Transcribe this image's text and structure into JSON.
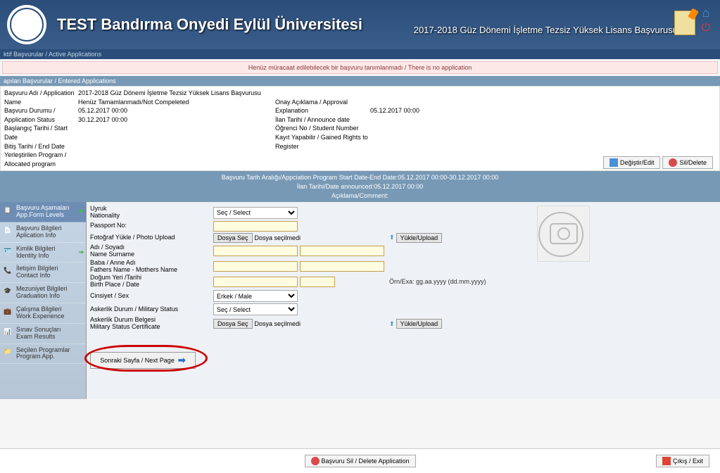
{
  "header": {
    "title": "TEST Bandırma Onyedi Eylül Üniversitesi",
    "subtitle": "2017-2018 Güz Dönemi İşletme Tezsiz Yüksek Lisans Başvurusu"
  },
  "breadcrumb": "ktif Başvurular / Active Applications",
  "notice": "Henüz müracaat edilebilecek bir başvuru tanımlanmadı / There is no application",
  "section_title": "apılan Başvurular / Entered Applications",
  "info": {
    "labels": {
      "app_name": "Başvuru Adı / Application Name",
      "app_status": "Başvuru Durumu / Application Status",
      "start_date": "Başlangıç Tarihi / Start Date",
      "end_date": "Bitiş Tarihi / End Date",
      "allocated": "Yerleştirilen Program / Allocated program",
      "approval": "Onay Açıklama / Approval Explanation",
      "announce": "İlan Tarihi / Announce date",
      "student_no": "Öğrenci No / Student Number",
      "register": "Kayıt Yapabilir / Gained Rights to Register"
    },
    "values": {
      "app_name": "2017-2018 Güz Dönemi İşletme Tezsiz Yüksek Lisans Başvurusu",
      "app_status": "Henüz Tamamlanmadı/Not Compeleted",
      "start_date": "05.12.2017 00:00",
      "end_date": "30.12.2017 00:00",
      "announce": "05.12.2017 00:00"
    },
    "buttons": {
      "edit": "Değiştir/Edit",
      "delete": "Sil/Delete"
    }
  },
  "strip": {
    "line1": "Başvuru Tarih Aralığı/Appciation Program Start Date-End Date:05.12.2017 00:00-30.12.2017 00:00",
    "line2": "İlan Tarihi/Date announced:05.12.2017 00:00",
    "line3": "Açıklama/Comment:"
  },
  "sidebar": [
    {
      "l1": "Başvuru Aşamaları",
      "l2": "App.Form Levels"
    },
    {
      "l1": "Başvuru Bilgileri",
      "l2": "Aplication Info"
    },
    {
      "l1": "Kimlik Bilgileri",
      "l2": "Identity Info"
    },
    {
      "l1": "İletişim Bilgileri",
      "l2": "Contact Info"
    },
    {
      "l1": "Mezuniyet Bilgileri",
      "l2": "Graduation Info"
    },
    {
      "l1": "Çalışma Bilgileri",
      "l2": "Work Experience"
    },
    {
      "l1": "Sınav Sonuçları",
      "l2": "Exam Results"
    },
    {
      "l1": "Seçilen Programlar",
      "l2": "Program App."
    }
  ],
  "form": {
    "nationality": {
      "l1": "Uyruk",
      "l2": "Nationality"
    },
    "passport": {
      "l1": "Passport No:"
    },
    "photo": {
      "l1": "Fotoğraf Yükle / Photo Upload"
    },
    "name": {
      "l1": "Adı / Soyadı",
      "l2": "Name Surname"
    },
    "parents": {
      "l1": "Baba / Anne Adı",
      "l2": "Fathers Name - Mothers Name"
    },
    "birth": {
      "l1": "Doğum Yeri /Tarihi",
      "l2": "Birth Place / Date"
    },
    "gender": {
      "l1": "Cinsiyet / Sex"
    },
    "military": {
      "l1": "Askerlik Durum / Military Status"
    },
    "military_cert": {
      "l1": "Askerlik Durum Belgesi",
      "l2": "Military Status Certificate"
    },
    "select_default": "Seç / Select",
    "gender_value": "Erkek / Male",
    "file_btn": "Dosya Seç",
    "file_status": "Dosya seçilmedi",
    "upload": "Yükle/Upload",
    "date_hint": "Örn/Exa: gg.aa.yyyy (dd.mm.yyyy)",
    "next": "Sonraki Sayfa / Next Page"
  },
  "footer": {
    "delete_app": "Başvuru Sil / Delete Application",
    "exit": "Çıkış / Exit"
  }
}
